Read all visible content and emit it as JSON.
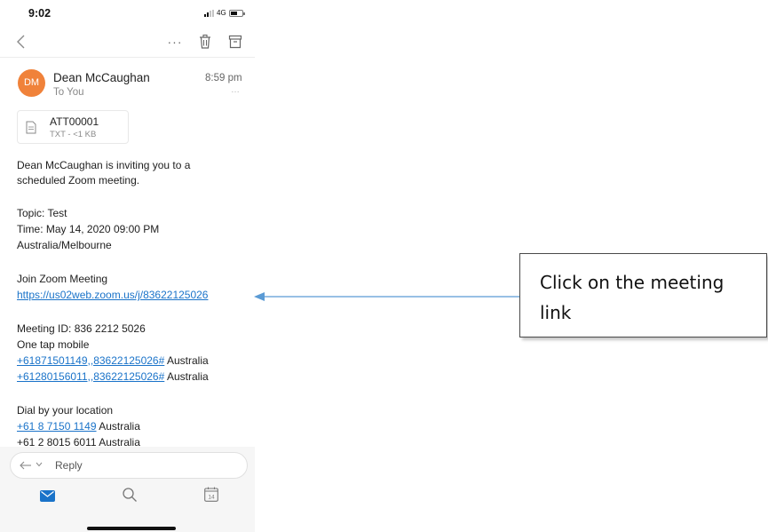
{
  "status_bar": {
    "time": "9:02",
    "network": "4G"
  },
  "email": {
    "sender_initials": "DM",
    "sender_name": "Dean McCaughan",
    "recipient": "To You",
    "time_sent": "8:59 pm",
    "header_more": "…",
    "attachment": {
      "name": "ATT00001",
      "meta": "TXT - <1 KB"
    },
    "body": {
      "intro_line1": "Dean McCaughan is inviting you to a",
      "intro_line2": "scheduled Zoom meeting.",
      "topic": "Topic: Test",
      "time_line1": "Time: May 14, 2020 09:00 PM",
      "time_line2": "Australia/Melbourne",
      "join_label": "Join Zoom Meeting",
      "join_link": "https://us02web.zoom.us/j/83622125026",
      "meeting_id": "Meeting ID: 836 2212 5026",
      "one_tap": "One tap mobile",
      "tap1_link": "+61871501149,,83622125026#",
      "tap1_country": " Australia",
      "tap2_link": "+61280156011,,83622125026#",
      "tap2_country": " Australia",
      "dial_label": "Dial by your location",
      "dial1_link": "+61 8 7150 1149",
      "dial1_country": " Australia",
      "dial2_text": "+61 2 8015 6011 Australia"
    }
  },
  "toolbar": {
    "more": "···"
  },
  "reply": {
    "label": "Reply"
  },
  "tab_bar": {
    "calendar_day": "14"
  },
  "callout": {
    "text": "Click on the meeting link"
  },
  "colors": {
    "link": "#1a73c9",
    "avatar": "#f0823a",
    "accent": "#1a73c9",
    "arrow": "#5b9bd5"
  }
}
